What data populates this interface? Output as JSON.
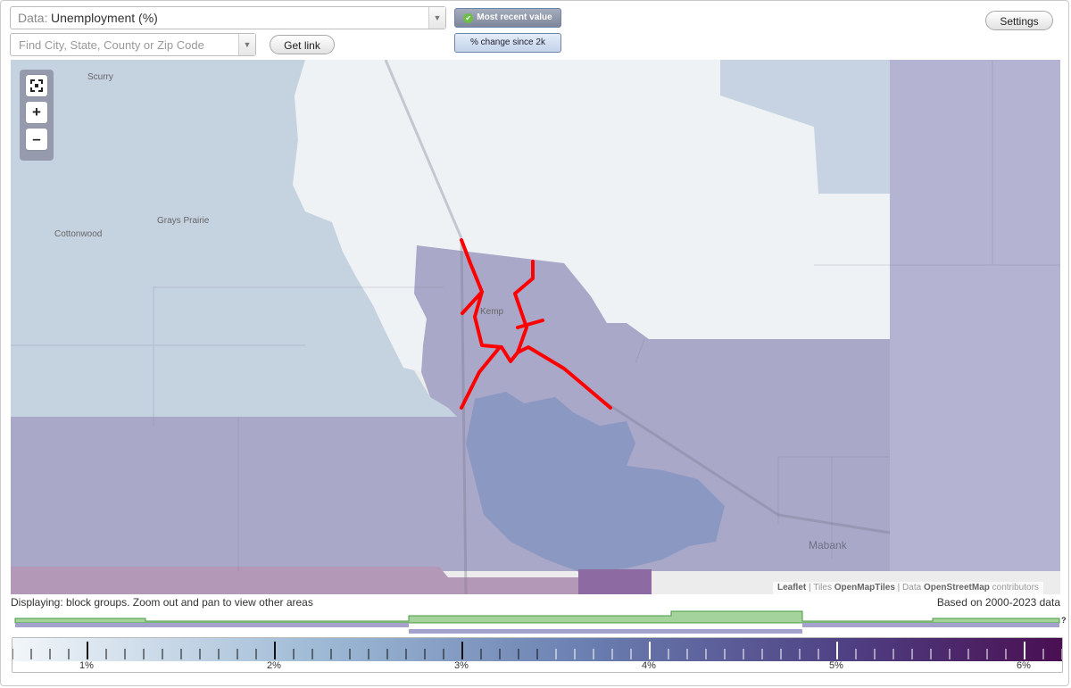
{
  "controls": {
    "data_prefix": "Data:",
    "data_value": "Unemployment (%)",
    "search_placeholder": "Find City, State, County or Zip Code",
    "get_link": "Get link",
    "settings": "Settings",
    "mode_active": "Most recent value",
    "mode_inactive": "% change since 2k"
  },
  "map": {
    "places": [
      "Scurry",
      "Grays Prairie",
      "Cottonwood",
      "Kemp",
      "Mabank"
    ],
    "highlight_color": "#ff0000",
    "attribution": {
      "leaflet": "Leaflet",
      "sep1": " | Tiles ",
      "tiles": "OpenMapTiles",
      "sep2": " | Data ",
      "data": "OpenStreetMap",
      "contrib": " contributors"
    }
  },
  "footer": {
    "displaying": "Displaying: block groups. Zoom out and pan to view other areas",
    "based_on": "Based on 2000-2023 data",
    "help": "?"
  },
  "legend": {
    "min": 0.6,
    "max": 6.2,
    "labels": [
      "1%",
      "2%",
      "3%",
      "4%",
      "5%",
      "6%"
    ],
    "colors": [
      "#f2f6fa",
      "#9cb8d4",
      "#6a7eb0",
      "#4e3f82",
      "#4a0f52"
    ]
  }
}
